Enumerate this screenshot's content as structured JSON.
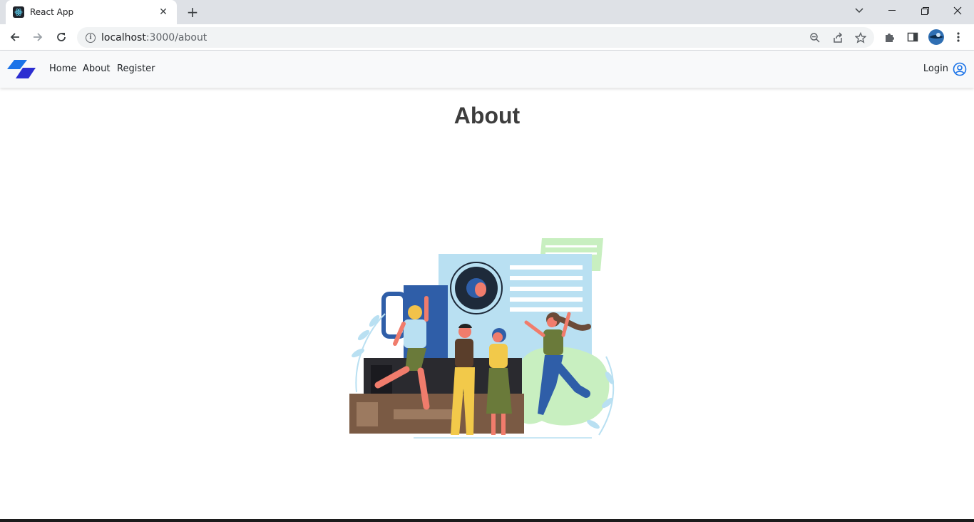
{
  "browser": {
    "tab_title": "React App",
    "url_host": "localhost",
    "url_path": ":3000/about"
  },
  "navbar": {
    "links": [
      "Home",
      "About",
      "Register"
    ],
    "login_label": "Login"
  },
  "main": {
    "title": "About"
  },
  "colors": {
    "brand_blue": "#1a73e8",
    "brand_dark": "#2c2ed1",
    "navbar_bg": "#f8f9fa"
  }
}
